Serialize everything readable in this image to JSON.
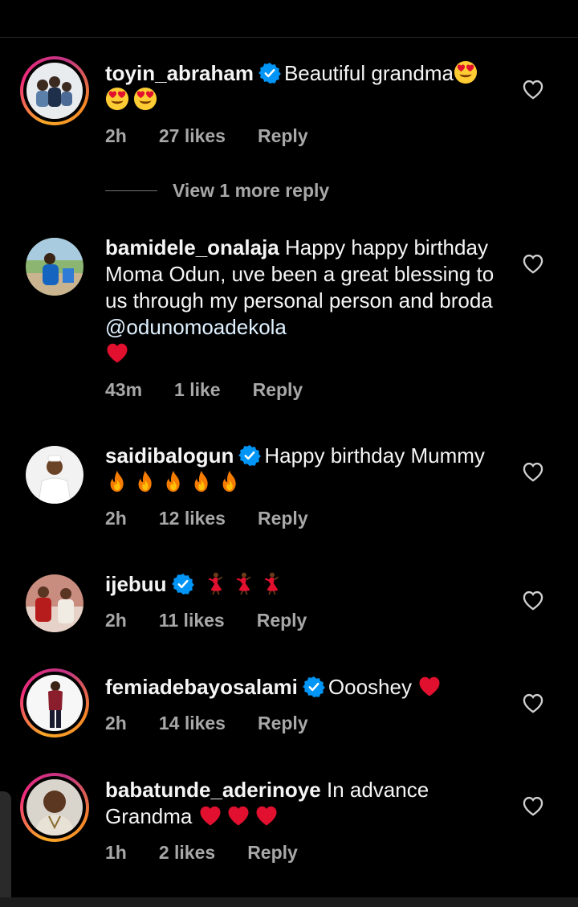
{
  "view_more": {
    "label": "View 1 more reply"
  },
  "comments": [
    {
      "username": "toyin_abraham",
      "verified": true,
      "text": "Beautiful grandma",
      "emojis": [
        "smiling-face-with-heart-eyes",
        "smiling-face-with-heart-eyes",
        "smiling-face-with-heart-eyes"
      ],
      "time": "2h",
      "likes": "27 likes",
      "reply": "Reply"
    },
    {
      "username": "bamidele_onalaja",
      "verified": false,
      "text": "Happy happy birthday Moma  Odun, uve been a great blessing to us through my personal person and broda ",
      "mention": "@odunomoadekola",
      "emojis": [
        "red-heart"
      ],
      "time": "43m",
      "likes": "1 like",
      "reply": "Reply"
    },
    {
      "username": "saidibalogun",
      "verified": true,
      "text": "Happy birthday Mummy",
      "emojis": [
        "fire",
        "fire",
        "fire",
        "fire",
        "fire"
      ],
      "time": "2h",
      "likes": "12 likes",
      "reply": "Reply"
    },
    {
      "username": "ijebuu",
      "verified": true,
      "text": "",
      "emojis": [
        "woman-dancing",
        "woman-dancing",
        "woman-dancing"
      ],
      "time": "2h",
      "likes": "11 likes",
      "reply": "Reply"
    },
    {
      "username": "femiadebayosalami",
      "verified": true,
      "text": "Oooshey",
      "emojis": [
        "red-heart"
      ],
      "time": "2h",
      "likes": "14 likes",
      "reply": "Reply"
    },
    {
      "username": "babatunde_aderinoye",
      "verified": false,
      "text": "In advance Grandma",
      "emojis": [
        "red-heart",
        "red-heart",
        "red-heart"
      ],
      "time": "1h",
      "likes": "2 likes",
      "reply": "Reply"
    }
  ],
  "colors": {
    "background": "#000000",
    "verified": "#0095f6",
    "meta": "#a8a8a8",
    "heart": "#e0102e"
  }
}
